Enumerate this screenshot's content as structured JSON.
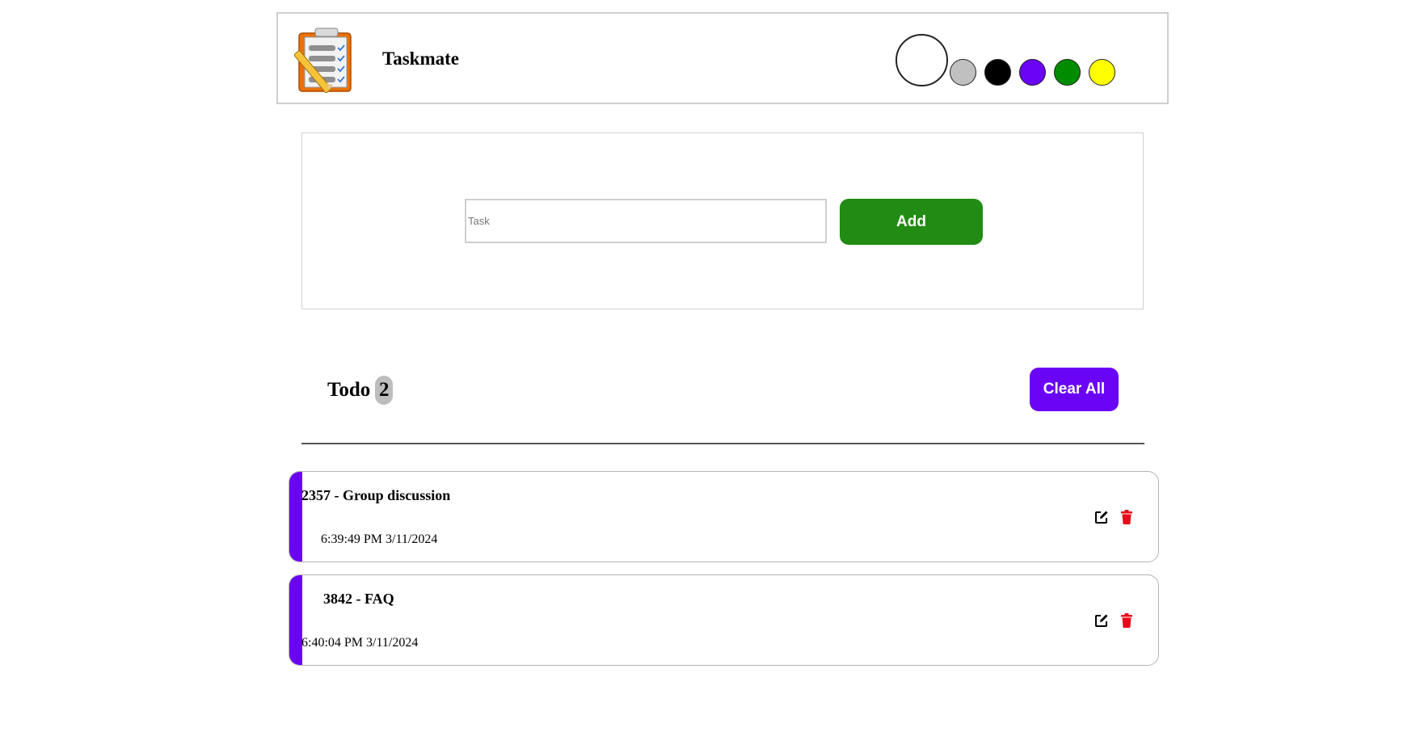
{
  "header": {
    "app_title": "Taskmate",
    "theme_colors": [
      {
        "name": "white",
        "hex": "#ffffff",
        "selected": true
      },
      {
        "name": "gray",
        "hex": "#c0c0c0"
      },
      {
        "name": "black",
        "hex": "#000000"
      },
      {
        "name": "purple",
        "hex": "#6a04f5"
      },
      {
        "name": "green",
        "hex": "#008c00"
      },
      {
        "name": "yellow",
        "hex": "#ffff00"
      }
    ]
  },
  "input_panel": {
    "task_placeholder": "Task",
    "task_value": "",
    "add_label": "Add"
  },
  "todo": {
    "label": "Todo",
    "count": "2",
    "clear_label": "Clear All"
  },
  "tasks": [
    {
      "title": "2357 - Group discussion",
      "time": "6:39:49 PM 3/11/2024"
    },
    {
      "title": "3842 - FAQ",
      "time": "6:40:04 PM 3/11/2024"
    }
  ],
  "icons": {
    "edit": "edit-icon",
    "delete": "trash-icon"
  },
  "colors": {
    "accent": "#6a04f5",
    "add_button": "#228b14",
    "delete_icon": "#e8091a"
  }
}
